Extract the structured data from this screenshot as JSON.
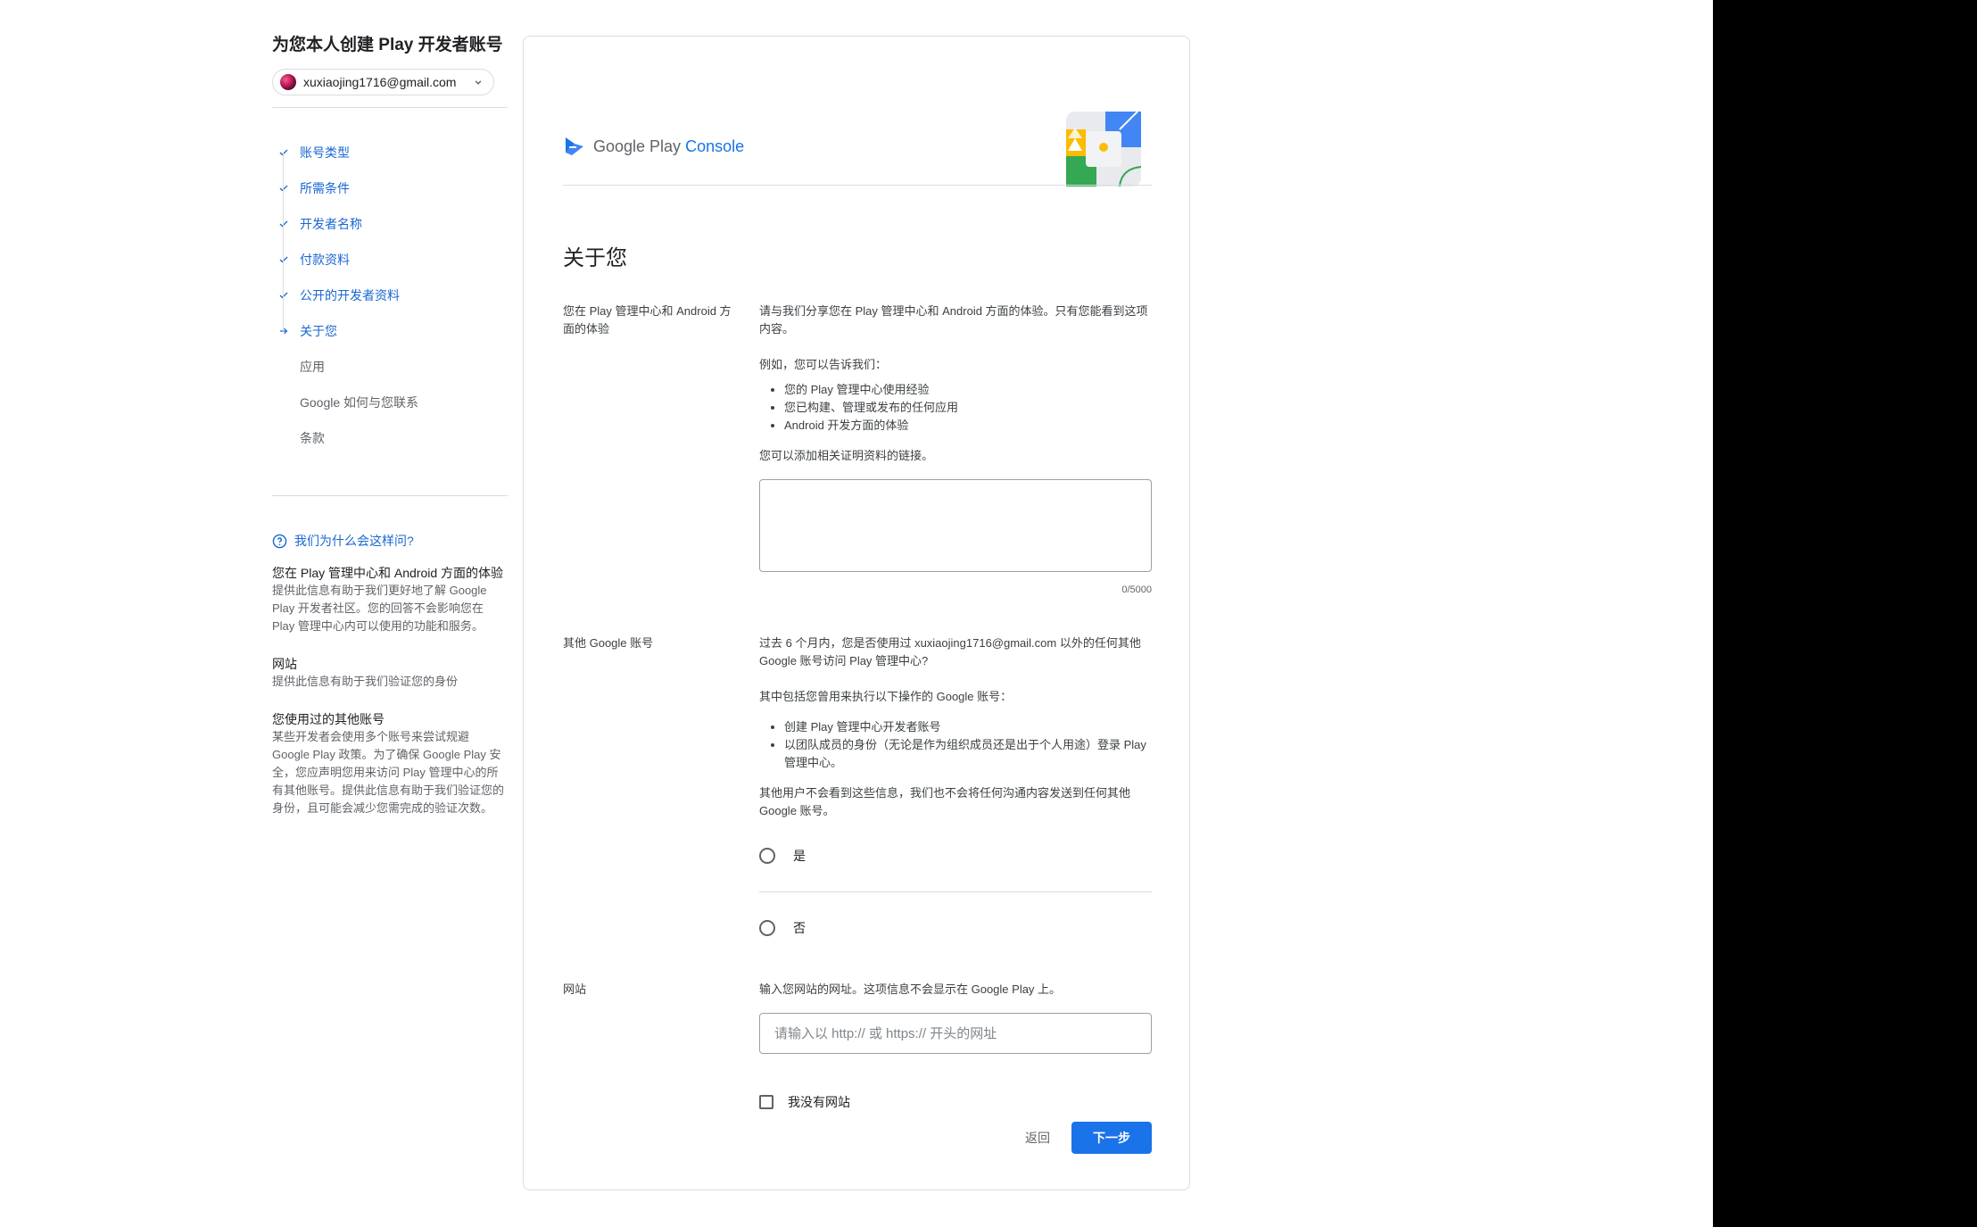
{
  "sidebar": {
    "page_title": "为您本人创建 Play 开发者账号",
    "account_email": "xuxiaojing1716@gmail.com",
    "steps": [
      {
        "label": "账号类型",
        "state": "done"
      },
      {
        "label": "所需条件",
        "state": "done"
      },
      {
        "label": "开发者名称",
        "state": "done"
      },
      {
        "label": "付款资料",
        "state": "done"
      },
      {
        "label": "公开的开发者资料",
        "state": "done"
      },
      {
        "label": "关于您",
        "state": "current"
      },
      {
        "label": "应用",
        "state": "todo"
      },
      {
        "label": "Google 如何与您联系",
        "state": "todo"
      },
      {
        "label": "条款",
        "state": "todo"
      }
    ],
    "help": {
      "link": "我们为什么会这样问?",
      "items": [
        {
          "title": "您在 Play 管理中心和 Android 方面的体验",
          "text": "提供此信息有助于我们更好地了解 Google Play 开发者社区。您的回答不会影响您在 Play 管理中心内可以使用的功能和服务。"
        },
        {
          "title": "网站",
          "text": "提供此信息有助于我们验证您的身份"
        },
        {
          "title": "您使用过的其他账号",
          "text": "某些开发者会使用多个账号来尝试规避 Google Play 政策。为了确保 Google Play 安全，您应声明您用来访问 Play 管理中心的所有其他账号。提供此信息有助于我们验证您的身份，且可能会减少您需完成的验证次数。"
        }
      ]
    }
  },
  "main": {
    "brand_google_play": "Google Play",
    "brand_console": "Console",
    "section_title": "关于您",
    "experience": {
      "label": "您在 Play 管理中心和 Android 方面的体验",
      "intro": "请与我们分享您在 Play 管理中心和 Android 方面的体验。只有您能看到这项内容。",
      "example_lead": "例如，您可以告诉我们：",
      "bullets": [
        "您的 Play 管理中心使用经验",
        "您已构建、管理或发布的任何应用",
        "Android 开发方面的体验"
      ],
      "links_note": "您可以添加相关证明资料的链接。",
      "counter": "0/5000"
    },
    "other_accounts": {
      "label": "其他 Google 账号",
      "question": "过去 6 个月内，您是否使用过 xuxiaojing1716@gmail.com 以外的任何其他 Google 账号访问 Play 管理中心?",
      "includes_lead": "其中包括您曾用来执行以下操作的 Google 账号：",
      "bullets": [
        "创建 Play 管理中心开发者账号",
        "以团队成员的身份（无论是作为组织成员还是出于个人用途）登录 Play 管理中心。"
      ],
      "privacy_note": "其他用户不会看到这些信息，我们也不会将任何沟通内容发送到任何其他 Google 账号。",
      "option_yes": "是",
      "option_no": "否"
    },
    "website": {
      "label": "网站",
      "intro": "输入您网站的网址。这项信息不会显示在 Google Play 上。",
      "placeholder": "请输入以 http:// 或 https:// 开头的网址",
      "no_website": "我没有网站"
    },
    "actions": {
      "back": "返回",
      "next": "下一步"
    }
  },
  "colors": {
    "accent": "#1a73e8",
    "link": "#1967d2",
    "border": "#dadce0"
  }
}
